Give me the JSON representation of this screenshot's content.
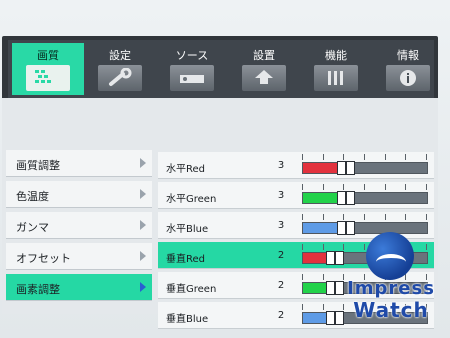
{
  "tabs": [
    {
      "label": "画質",
      "icon": "picture-quality-icon",
      "active": true
    },
    {
      "label": "設定",
      "icon": "wrench-icon",
      "active": false
    },
    {
      "label": "ソース",
      "icon": "source-icon",
      "active": false
    },
    {
      "label": "設置",
      "icon": "installation-icon",
      "active": false
    },
    {
      "label": "機能",
      "icon": "function-icon",
      "active": false
    },
    {
      "label": "情報",
      "icon": "info-icon",
      "active": false
    }
  ],
  "submenu": [
    {
      "label": "画質調整",
      "active": false
    },
    {
      "label": "色温度",
      "active": false
    },
    {
      "label": "ガンマ",
      "active": false
    },
    {
      "label": "オフセット",
      "active": false
    },
    {
      "label": "画素調整",
      "active": true
    }
  ],
  "settings": [
    {
      "label": "水平Red",
      "value": "3",
      "level": 3,
      "color": "#e2323e",
      "active": false
    },
    {
      "label": "水平Green",
      "value": "3",
      "level": 3,
      "color": "#22d24a",
      "active": false
    },
    {
      "label": "水平Blue",
      "value": "3",
      "level": 3,
      "color": "#5e9be6",
      "active": false
    },
    {
      "label": "垂直Red",
      "value": "2",
      "level": 2,
      "color": "#e2323e",
      "active": true
    },
    {
      "label": "垂直Green",
      "value": "2",
      "level": 2,
      "color": "#22d24a",
      "active": false
    },
    {
      "label": "垂直Blue",
      "value": "2",
      "level": 2,
      "color": "#5e9be6",
      "active": false
    }
  ],
  "slider_max": 6,
  "watermark": {
    "line1": "Impress",
    "line2": "Watch"
  },
  "colors": {
    "accent": "#29d9a6",
    "frame": "#31363b"
  }
}
